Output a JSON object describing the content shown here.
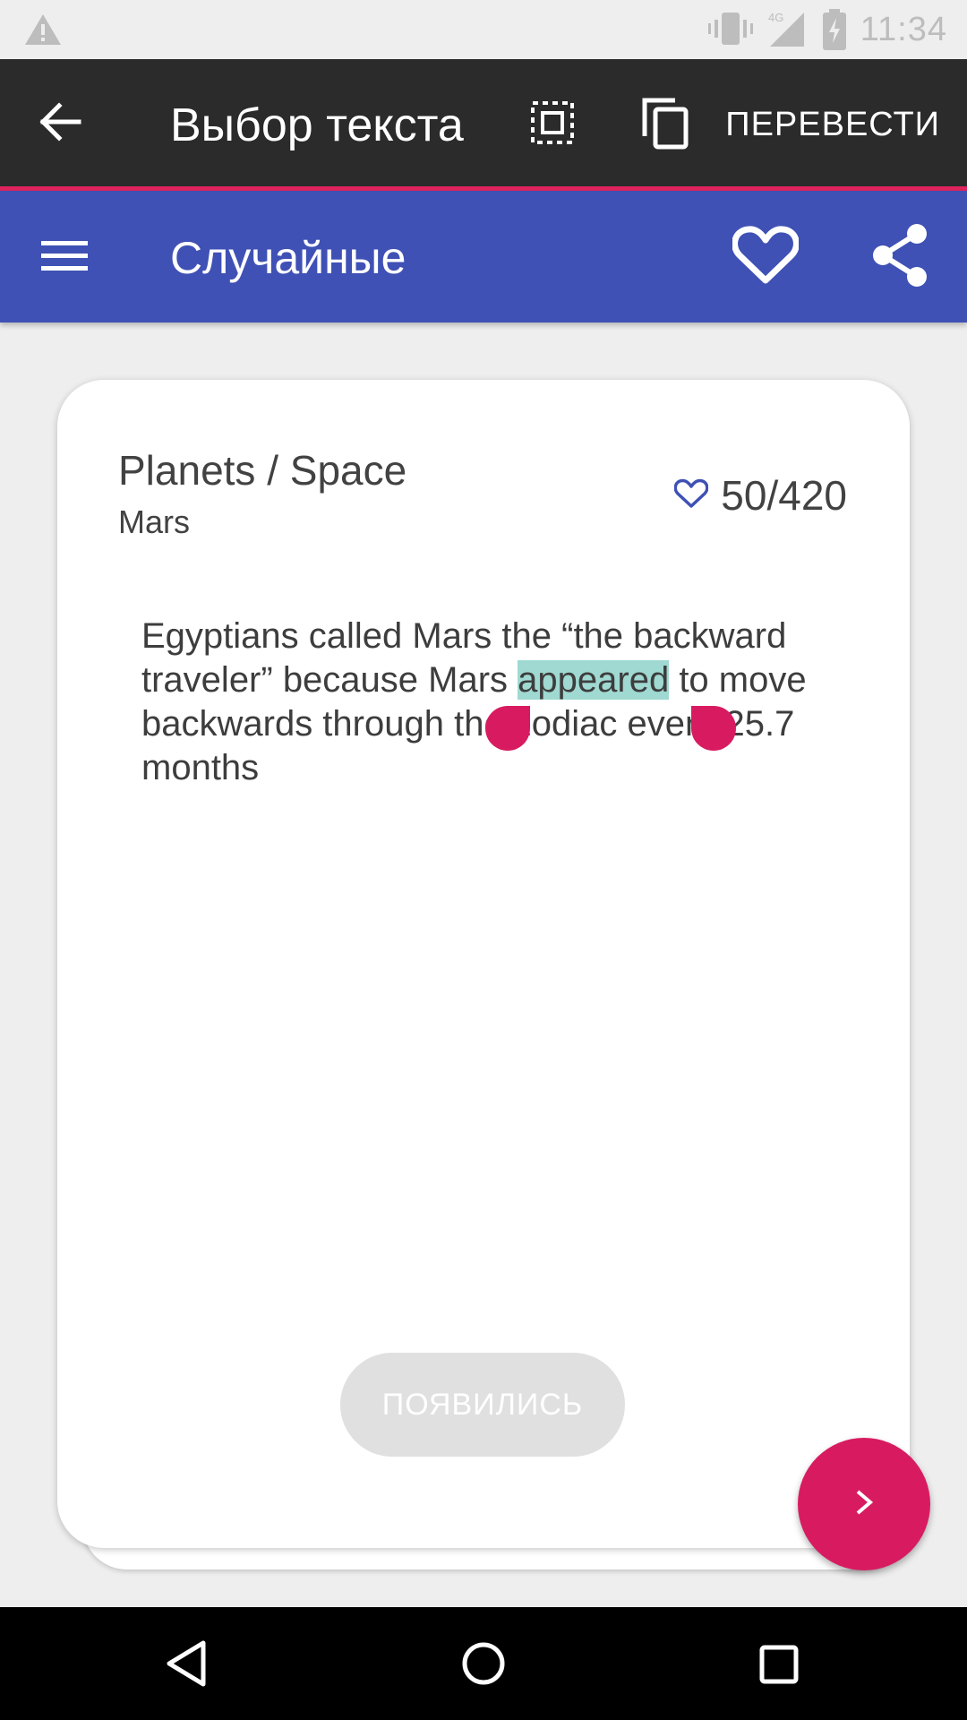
{
  "status_bar": {
    "time": "11:34",
    "network": "4G",
    "icons": [
      "warning-icon",
      "vibrate-icon",
      "signal-icon",
      "battery-charging-icon"
    ]
  },
  "action_mode": {
    "title": "Выбор текста",
    "translate_label": "ПЕРЕВЕСТИ",
    "icons": [
      "back-arrow-icon",
      "select-all-icon",
      "copy-icon"
    ]
  },
  "toolbar": {
    "title": "Случайные",
    "icons": [
      "menu-icon",
      "heart-outline-icon",
      "share-icon"
    ],
    "color": "#3f51b5"
  },
  "card": {
    "category": "Planets / Space",
    "subcategory": "Mars",
    "favorites_count": "50/420",
    "fact_before": "Egyptians called Mars the “the backward traveler” because Mars ",
    "fact_selected": "appeared",
    "fact_after": " to move backwards through the zodiac every 25.7 months",
    "translation_button": "ПОЯВИЛИСЬ"
  },
  "fab": {
    "icon": "chevron-right-icon",
    "color": "#d81b60"
  },
  "nav_bar": {
    "icons": [
      "nav-back-icon",
      "nav-home-icon",
      "nav-recents-icon"
    ]
  },
  "colors": {
    "accent": "#d81b60",
    "selection": "#9fd9d1",
    "action_bar": "#2b2b2b"
  }
}
